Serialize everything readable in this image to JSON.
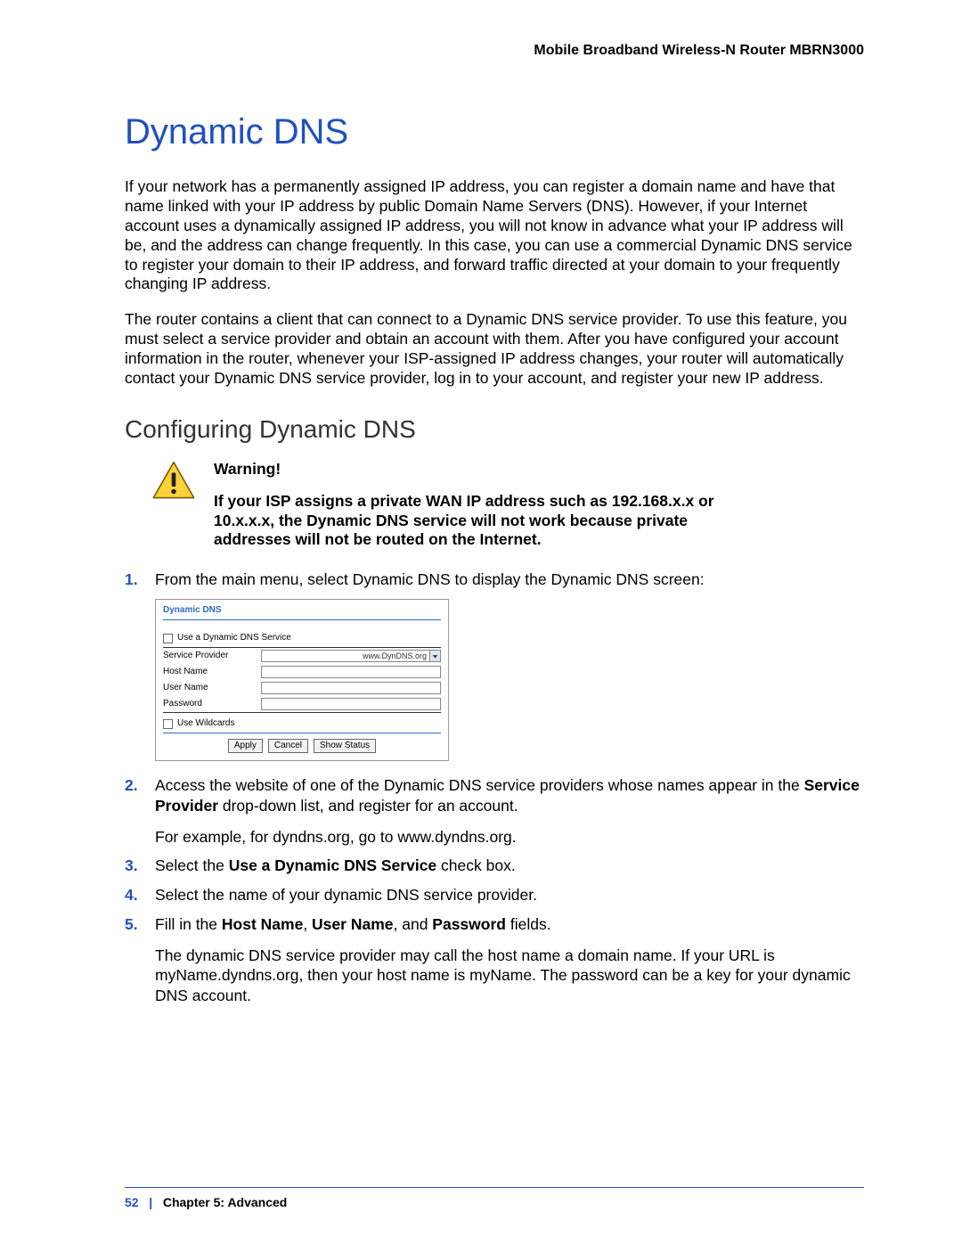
{
  "header": {
    "product": "Mobile Broadband Wireless-N Router MBRN3000"
  },
  "title": "Dynamic DNS",
  "para1": "If your network has a permanently assigned IP address, you can register a domain name and have that name linked with your IP address by public Domain Name Servers (DNS). However, if your Internet account uses a dynamically assigned IP address, you will not know in advance what your IP address will be, and the address can change frequently. In this case, you can use a commercial Dynamic DNS service to register your domain to their IP address, and forward traffic directed at your domain to your frequently changing IP address.",
  "para2": "The router contains a client that can connect to a Dynamic DNS service provider. To use this feature, you must select a service provider and obtain an account with them. After you have configured your account information in the router, whenever your ISP-assigned IP address changes, your router will automatically contact your Dynamic DNS service provider, log in to your account, and register your new IP address.",
  "subsection": "Configuring Dynamic DNS",
  "warning": {
    "label": "Warning!",
    "text": "If your ISP assigns a private WAN IP address such as 192.168.x.x or 10.x.x.x, the Dynamic DNS service will not work because private addresses will not be routed on the Internet."
  },
  "steps": {
    "s1": "From the main menu, select Dynamic DNS to display the Dynamic DNS screen:",
    "s2_pre": "Access the website of one of the Dynamic DNS service providers whose names appear in the ",
    "s2_bold": "Service Provider",
    "s2_post": " drop-down list, and register for an account.",
    "s2_extra": "For example, for dyndns.org, go to www.dyndns.org.",
    "s3_pre": "Select the ",
    "s3_bold": "Use a Dynamic DNS Service",
    "s3_post": " check box.",
    "s4": "Select the name of your dynamic DNS service provider.",
    "s5_pre": "Fill in the ",
    "s5_b1": "Host Name",
    "s5_m1": ", ",
    "s5_b2": "User Name",
    "s5_m2": ", and ",
    "s5_b3": "Password",
    "s5_post": " fields.",
    "s5_extra": "The dynamic DNS service provider may call the host name a domain name. If your URL is myName.dyndns.org, then your host name is myName. The password can be a key for your dynamic DNS account."
  },
  "app": {
    "title": "Dynamic DNS",
    "use_service": "Use a Dynamic DNS Service",
    "service_provider": "Service Provider",
    "provider_value": "www.DynDNS.org",
    "host_name": "Host Name",
    "user_name": "User Name",
    "password": "Password",
    "use_wildcards": "Use Wildcards",
    "apply": "Apply",
    "cancel": "Cancel",
    "show_status": "Show Status"
  },
  "footer": {
    "page": "52",
    "sep": "|",
    "chapter": "Chapter 5:  Advanced"
  }
}
